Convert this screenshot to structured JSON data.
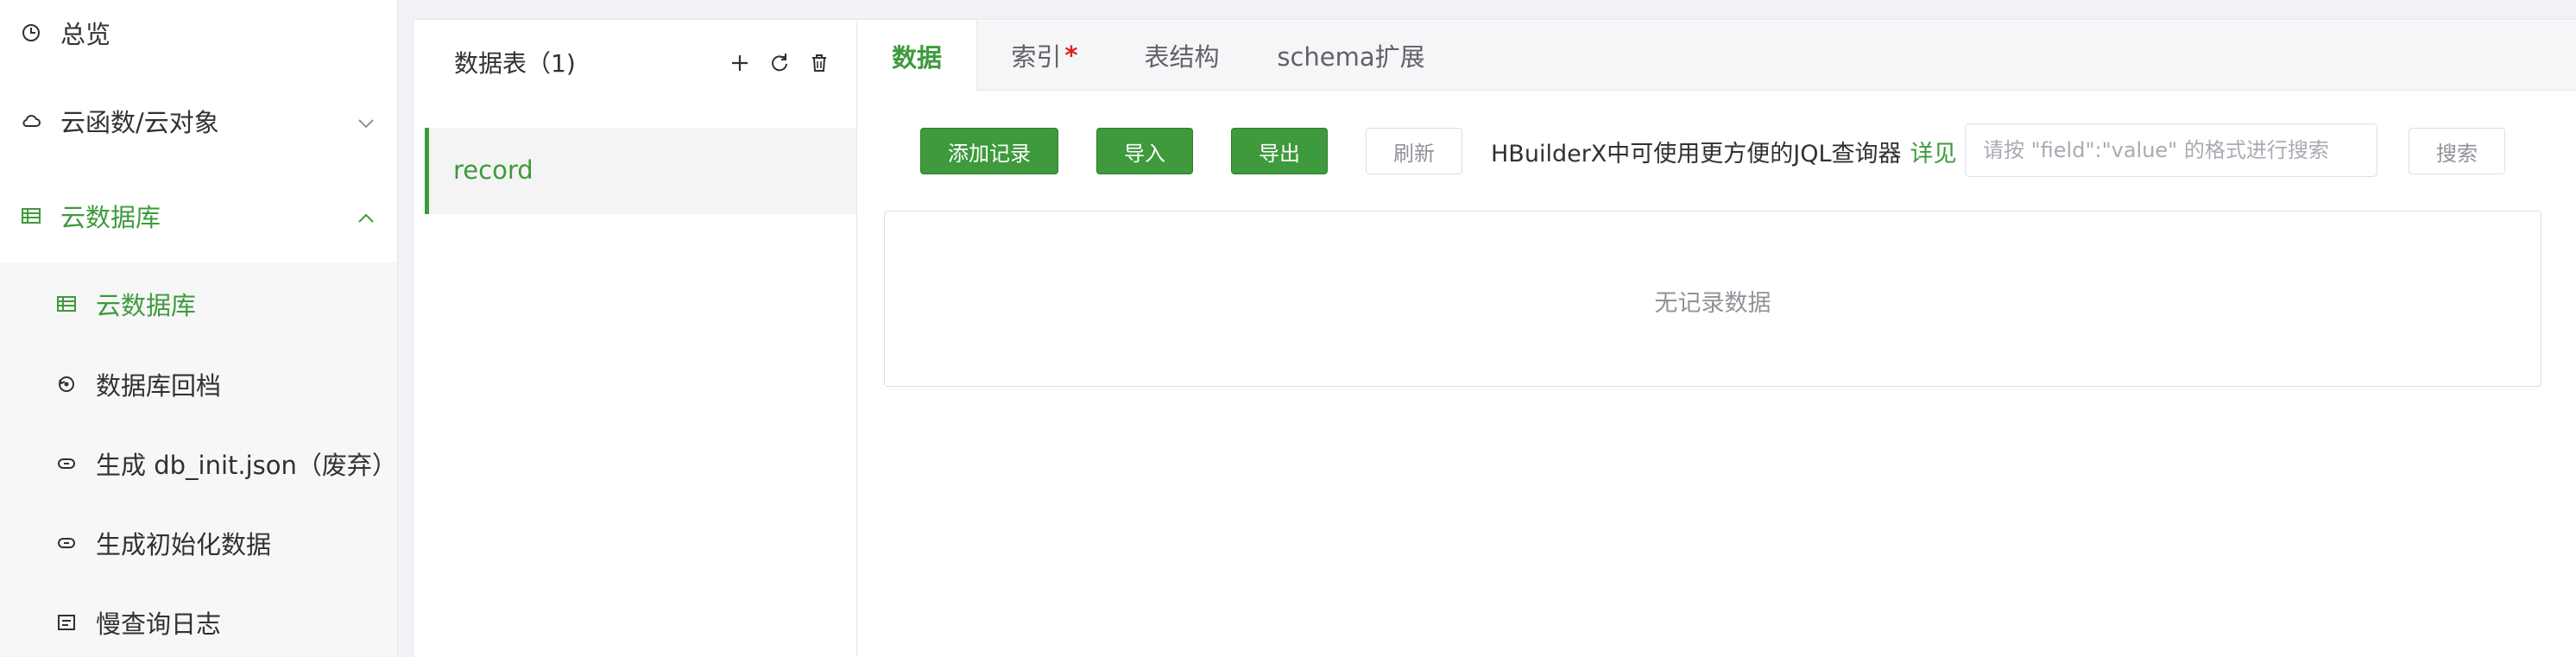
{
  "sidebar": {
    "items": [
      {
        "label": "总览",
        "icon": "clock-icon"
      },
      {
        "label": "云函数/云对象",
        "icon": "cloud-icon"
      },
      {
        "label": "云数据库",
        "icon": "database-icon"
      }
    ],
    "subitems": [
      {
        "label": "云数据库",
        "icon": "database-icon"
      },
      {
        "label": "数据库回档",
        "icon": "restore-icon"
      },
      {
        "label": "生成 db_init.json（废弃）",
        "icon": "link-icon"
      },
      {
        "label": "生成初始化数据",
        "icon": "link-icon"
      },
      {
        "label": "慢查询日志",
        "icon": "log-icon"
      }
    ]
  },
  "tablelist": {
    "title": "数据表（1)",
    "actions": [
      "plus-icon",
      "refresh-icon",
      "trash-icon"
    ],
    "tables": [
      "record"
    ]
  },
  "tabs": [
    {
      "label": "数据",
      "active": true
    },
    {
      "label": "索引",
      "badge": "*"
    },
    {
      "label": "表结构"
    },
    {
      "label": "schema扩展"
    }
  ],
  "toolbar": {
    "add_label": "添加记录",
    "import_label": "导入",
    "export_label": "导出",
    "refresh_label": "刷新",
    "hint": "HBuilderX中可使用更方便的JQL查询器",
    "hint_link": "详见",
    "search_placeholder": "请按 \"field\":\"value\" 的格式进行搜索",
    "search_label": "搜索"
  },
  "empty_text": "无记录数据",
  "colors": {
    "accent": "#3e9a3c",
    "danger": "#e02020"
  }
}
